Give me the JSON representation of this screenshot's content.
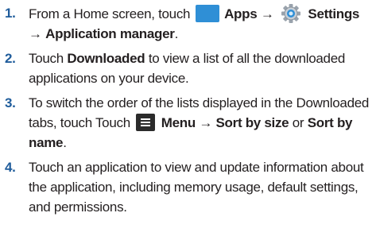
{
  "steps": [
    {
      "number": "1.",
      "t1": "From a Home screen, touch",
      "b1": "Apps",
      "arrow1": "→",
      "b2": "Settings",
      "arrow2": "→",
      "b3": "Application manager",
      "end": "."
    },
    {
      "number": "2.",
      "t1": "Touch",
      "b1": "Downloaded",
      "t2": "to view a list of all the downloaded applications on your device."
    },
    {
      "number": "3.",
      "t1": "To switch the order of the lists displayed in the Downloaded tabs, touch Touch",
      "b1": "Menu",
      "arrow1": "→",
      "b2": "Sort by size",
      "t2": "or",
      "b3": "Sort by name",
      "end": "."
    },
    {
      "number": "4.",
      "t1": "Touch an application to view and update information about the application, including memory usage, default settings, and permissions."
    }
  ],
  "icons": {
    "apps": "apps-grid-icon",
    "settings": "settings-gear-icon",
    "menu": "menu-icon"
  },
  "colors": {
    "step_number": "#1f5c9b",
    "apps_icon": "#2f8fd6",
    "menu_icon": "#2b2b2b"
  }
}
